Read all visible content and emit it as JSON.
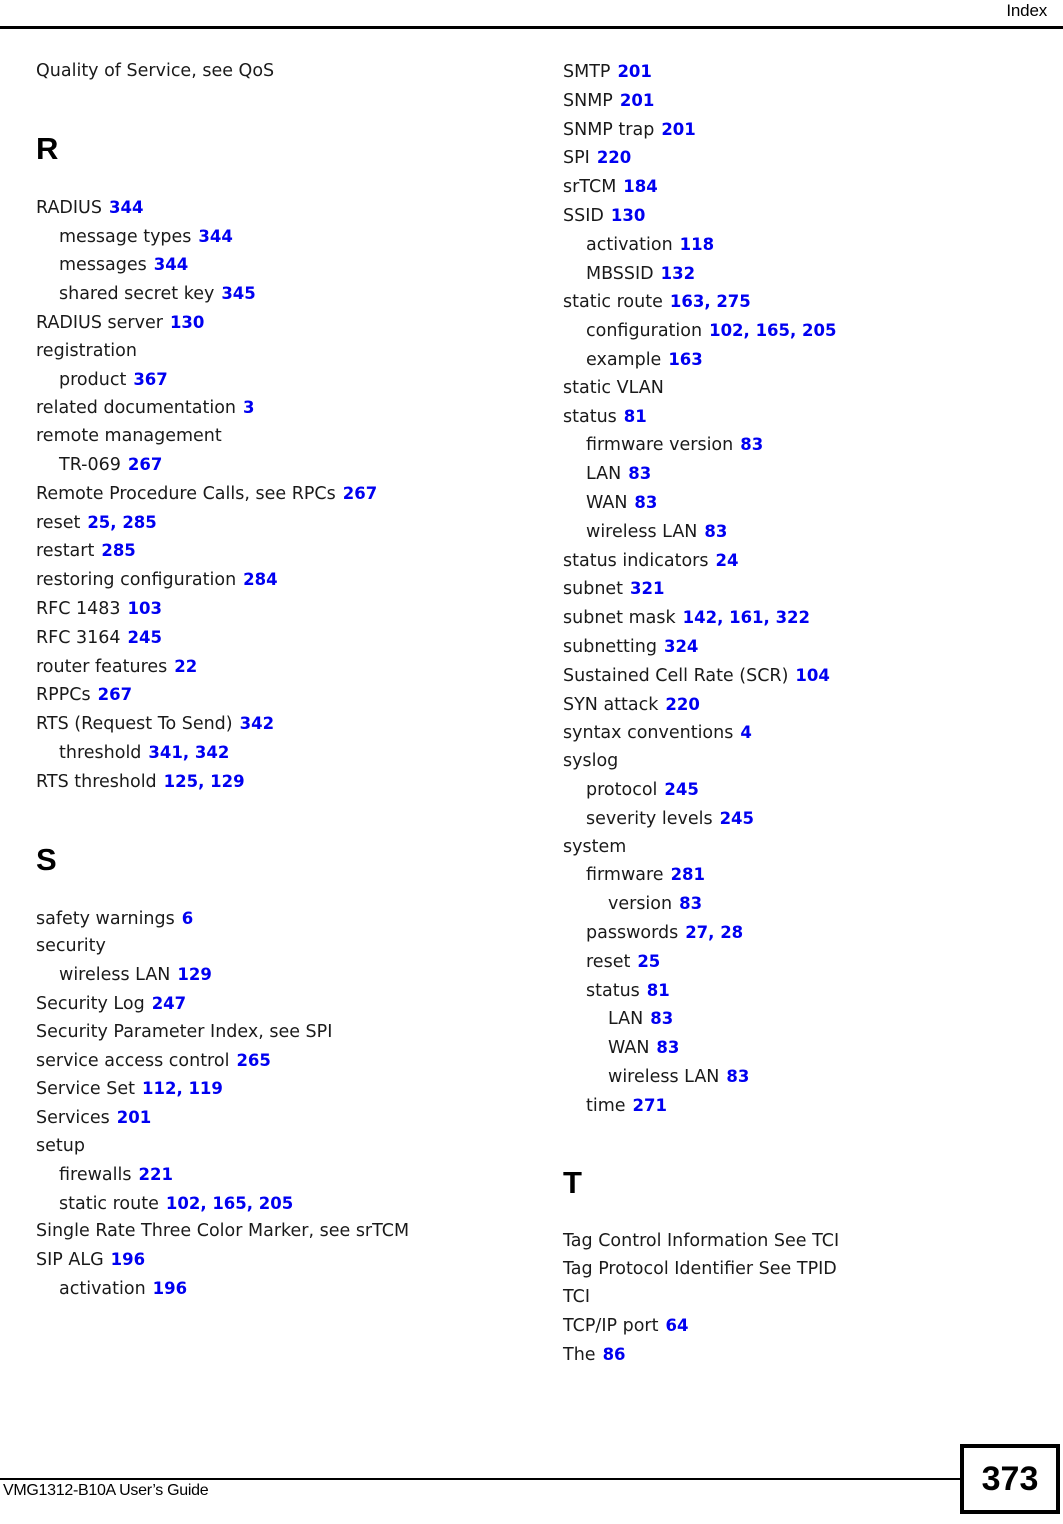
{
  "header": {
    "title": "Index"
  },
  "footer": {
    "guide_name": "VMG1312-B10A User’s Guide",
    "page_number": "373"
  },
  "colors": {
    "page_number_link": "#0000f0",
    "text": "#1a1a1a",
    "rule": "#000000"
  },
  "columns": [
    {
      "id": "left",
      "blocks": [
        {
          "type": "entries",
          "entries": [
            {
              "level": 1,
              "term": "Quality of Service, see QoS",
              "pages": []
            }
          ]
        },
        {
          "type": "heading",
          "letter": "R"
        },
        {
          "type": "entries",
          "entries": [
            {
              "level": 1,
              "term": "RADIUS",
              "pages": [
                "344"
              ]
            },
            {
              "level": 2,
              "term": "message types",
              "pages": [
                "344"
              ]
            },
            {
              "level": 2,
              "term": "messages",
              "pages": [
                "344"
              ]
            },
            {
              "level": 2,
              "term": "shared secret key",
              "pages": [
                "345"
              ]
            },
            {
              "level": 1,
              "term": "RADIUS server",
              "pages": [
                "130"
              ]
            },
            {
              "level": 1,
              "term": "registration",
              "pages": []
            },
            {
              "level": 2,
              "term": "product",
              "pages": [
                "367"
              ]
            },
            {
              "level": 1,
              "term": "related documentation",
              "pages": [
                "3"
              ]
            },
            {
              "level": 1,
              "term": "remote management",
              "pages": []
            },
            {
              "level": 2,
              "term": "TR-069",
              "pages": [
                "267"
              ]
            },
            {
              "level": 1,
              "term": "Remote Procedure Calls, see RPCs",
              "pages": [
                "267"
              ]
            },
            {
              "level": 1,
              "term": "reset",
              "pages": [
                "25",
                "285"
              ]
            },
            {
              "level": 1,
              "term": "restart",
              "pages": [
                "285"
              ]
            },
            {
              "level": 1,
              "term": "restoring configuration",
              "pages": [
                "284"
              ]
            },
            {
              "level": 1,
              "term": "RFC 1483",
              "pages": [
                "103"
              ]
            },
            {
              "level": 1,
              "term": "RFC 3164",
              "pages": [
                "245"
              ]
            },
            {
              "level": 1,
              "term": "router features",
              "pages": [
                "22"
              ]
            },
            {
              "level": 1,
              "term": "RPPCs",
              "pages": [
                "267"
              ]
            },
            {
              "level": 1,
              "term": "RTS (Request To Send)",
              "pages": [
                "342"
              ]
            },
            {
              "level": 2,
              "term": "threshold",
              "pages": [
                "341",
                "342"
              ]
            },
            {
              "level": 1,
              "term": "RTS threshold",
              "pages": [
                "125",
                "129"
              ]
            }
          ]
        },
        {
          "type": "heading",
          "letter": "S"
        },
        {
          "type": "entries",
          "entries": [
            {
              "level": 1,
              "term": "safety warnings",
              "pages": [
                "6"
              ]
            },
            {
              "level": 1,
              "term": "security",
              "pages": []
            },
            {
              "level": 2,
              "term": "wireless LAN",
              "pages": [
                "129"
              ]
            },
            {
              "level": 1,
              "term": "Security Log",
              "pages": [
                "247"
              ]
            },
            {
              "level": 1,
              "term": "Security Parameter Index, see SPI",
              "pages": []
            },
            {
              "level": 1,
              "term": "service access control",
              "pages": [
                "265"
              ]
            },
            {
              "level": 1,
              "term": "Service Set",
              "pages": [
                "112",
                "119"
              ]
            },
            {
              "level": 1,
              "term": "Services",
              "pages": [
                "201"
              ]
            },
            {
              "level": 1,
              "term": "setup",
              "pages": []
            },
            {
              "level": 2,
              "term": "firewalls",
              "pages": [
                "221"
              ]
            },
            {
              "level": 2,
              "term": "static route",
              "pages": [
                "102",
                "165",
                "205"
              ]
            },
            {
              "level": 1,
              "term": "Single Rate Three Color Marker, see srTCM",
              "pages": []
            },
            {
              "level": 1,
              "term": "SIP ALG",
              "pages": [
                "196"
              ]
            },
            {
              "level": 2,
              "term": "activation",
              "pages": [
                "196"
              ]
            }
          ]
        }
      ]
    },
    {
      "id": "right",
      "blocks": [
        {
          "type": "entries",
          "entries": [
            {
              "level": 1,
              "term": "SMTP",
              "pages": [
                "201"
              ]
            },
            {
              "level": 1,
              "term": "SNMP",
              "pages": [
                "201"
              ]
            },
            {
              "level": 1,
              "term": "SNMP trap",
              "pages": [
                "201"
              ]
            },
            {
              "level": 1,
              "term": "SPI",
              "pages": [
                "220"
              ]
            },
            {
              "level": 1,
              "term": "srTCM",
              "pages": [
                "184"
              ]
            },
            {
              "level": 1,
              "term": "SSID",
              "pages": [
                "130"
              ]
            },
            {
              "level": 2,
              "term": "activation",
              "pages": [
                "118"
              ]
            },
            {
              "level": 2,
              "term": "MBSSID",
              "pages": [
                "132"
              ]
            },
            {
              "level": 1,
              "term": "static route",
              "pages": [
                "163",
                "275"
              ]
            },
            {
              "level": 2,
              "term": "configuration",
              "pages": [
                "102",
                "165",
                "205"
              ]
            },
            {
              "level": 2,
              "term": "example",
              "pages": [
                "163"
              ]
            },
            {
              "level": 1,
              "term": "static VLAN",
              "pages": []
            },
            {
              "level": 1,
              "term": "status",
              "pages": [
                "81"
              ]
            },
            {
              "level": 2,
              "term": "firmware version",
              "pages": [
                "83"
              ]
            },
            {
              "level": 2,
              "term": "LAN",
              "pages": [
                "83"
              ]
            },
            {
              "level": 2,
              "term": "WAN",
              "pages": [
                "83"
              ]
            },
            {
              "level": 2,
              "term": "wireless LAN",
              "pages": [
                "83"
              ]
            },
            {
              "level": 1,
              "term": "status indicators",
              "pages": [
                "24"
              ]
            },
            {
              "level": 1,
              "term": "subnet",
              "pages": [
                "321"
              ]
            },
            {
              "level": 1,
              "term": "subnet mask",
              "pages": [
                "142",
                "161",
                "322"
              ]
            },
            {
              "level": 1,
              "term": "subnetting",
              "pages": [
                "324"
              ]
            },
            {
              "level": 1,
              "term": "Sustained Cell Rate (SCR)",
              "pages": [
                "104"
              ]
            },
            {
              "level": 1,
              "term": "SYN attack",
              "pages": [
                "220"
              ]
            },
            {
              "level": 1,
              "term": "syntax conventions",
              "pages": [
                "4"
              ]
            },
            {
              "level": 1,
              "term": "syslog",
              "pages": []
            },
            {
              "level": 2,
              "term": "protocol",
              "pages": [
                "245"
              ]
            },
            {
              "level": 2,
              "term": "severity levels",
              "pages": [
                "245"
              ]
            },
            {
              "level": 1,
              "term": "system",
              "pages": []
            },
            {
              "level": 2,
              "term": "firmware",
              "pages": [
                "281"
              ]
            },
            {
              "level": 3,
              "term": "version",
              "pages": [
                "83"
              ]
            },
            {
              "level": 2,
              "term": "passwords",
              "pages": [
                "27",
                "28"
              ]
            },
            {
              "level": 2,
              "term": "reset",
              "pages": [
                "25"
              ]
            },
            {
              "level": 2,
              "term": "status",
              "pages": [
                "81"
              ]
            },
            {
              "level": 3,
              "term": "LAN",
              "pages": [
                "83"
              ]
            },
            {
              "level": 3,
              "term": "WAN",
              "pages": [
                "83"
              ]
            },
            {
              "level": 3,
              "term": "wireless LAN",
              "pages": [
                "83"
              ]
            },
            {
              "level": 2,
              "term": "time",
              "pages": [
                "271"
              ]
            }
          ]
        },
        {
          "type": "heading",
          "letter": "T"
        },
        {
          "type": "entries",
          "entries": [
            {
              "level": 1,
              "term": "Tag Control Information See TCI",
              "pages": []
            },
            {
              "level": 1,
              "term": "Tag Protocol Identifier See TPID",
              "pages": []
            },
            {
              "level": 1,
              "term": "TCI",
              "pages": []
            },
            {
              "level": 1,
              "term": "TCP/IP port",
              "pages": [
                "64"
              ]
            },
            {
              "level": 1,
              "term": "The",
              "pages": [
                "86"
              ]
            }
          ]
        }
      ]
    }
  ]
}
